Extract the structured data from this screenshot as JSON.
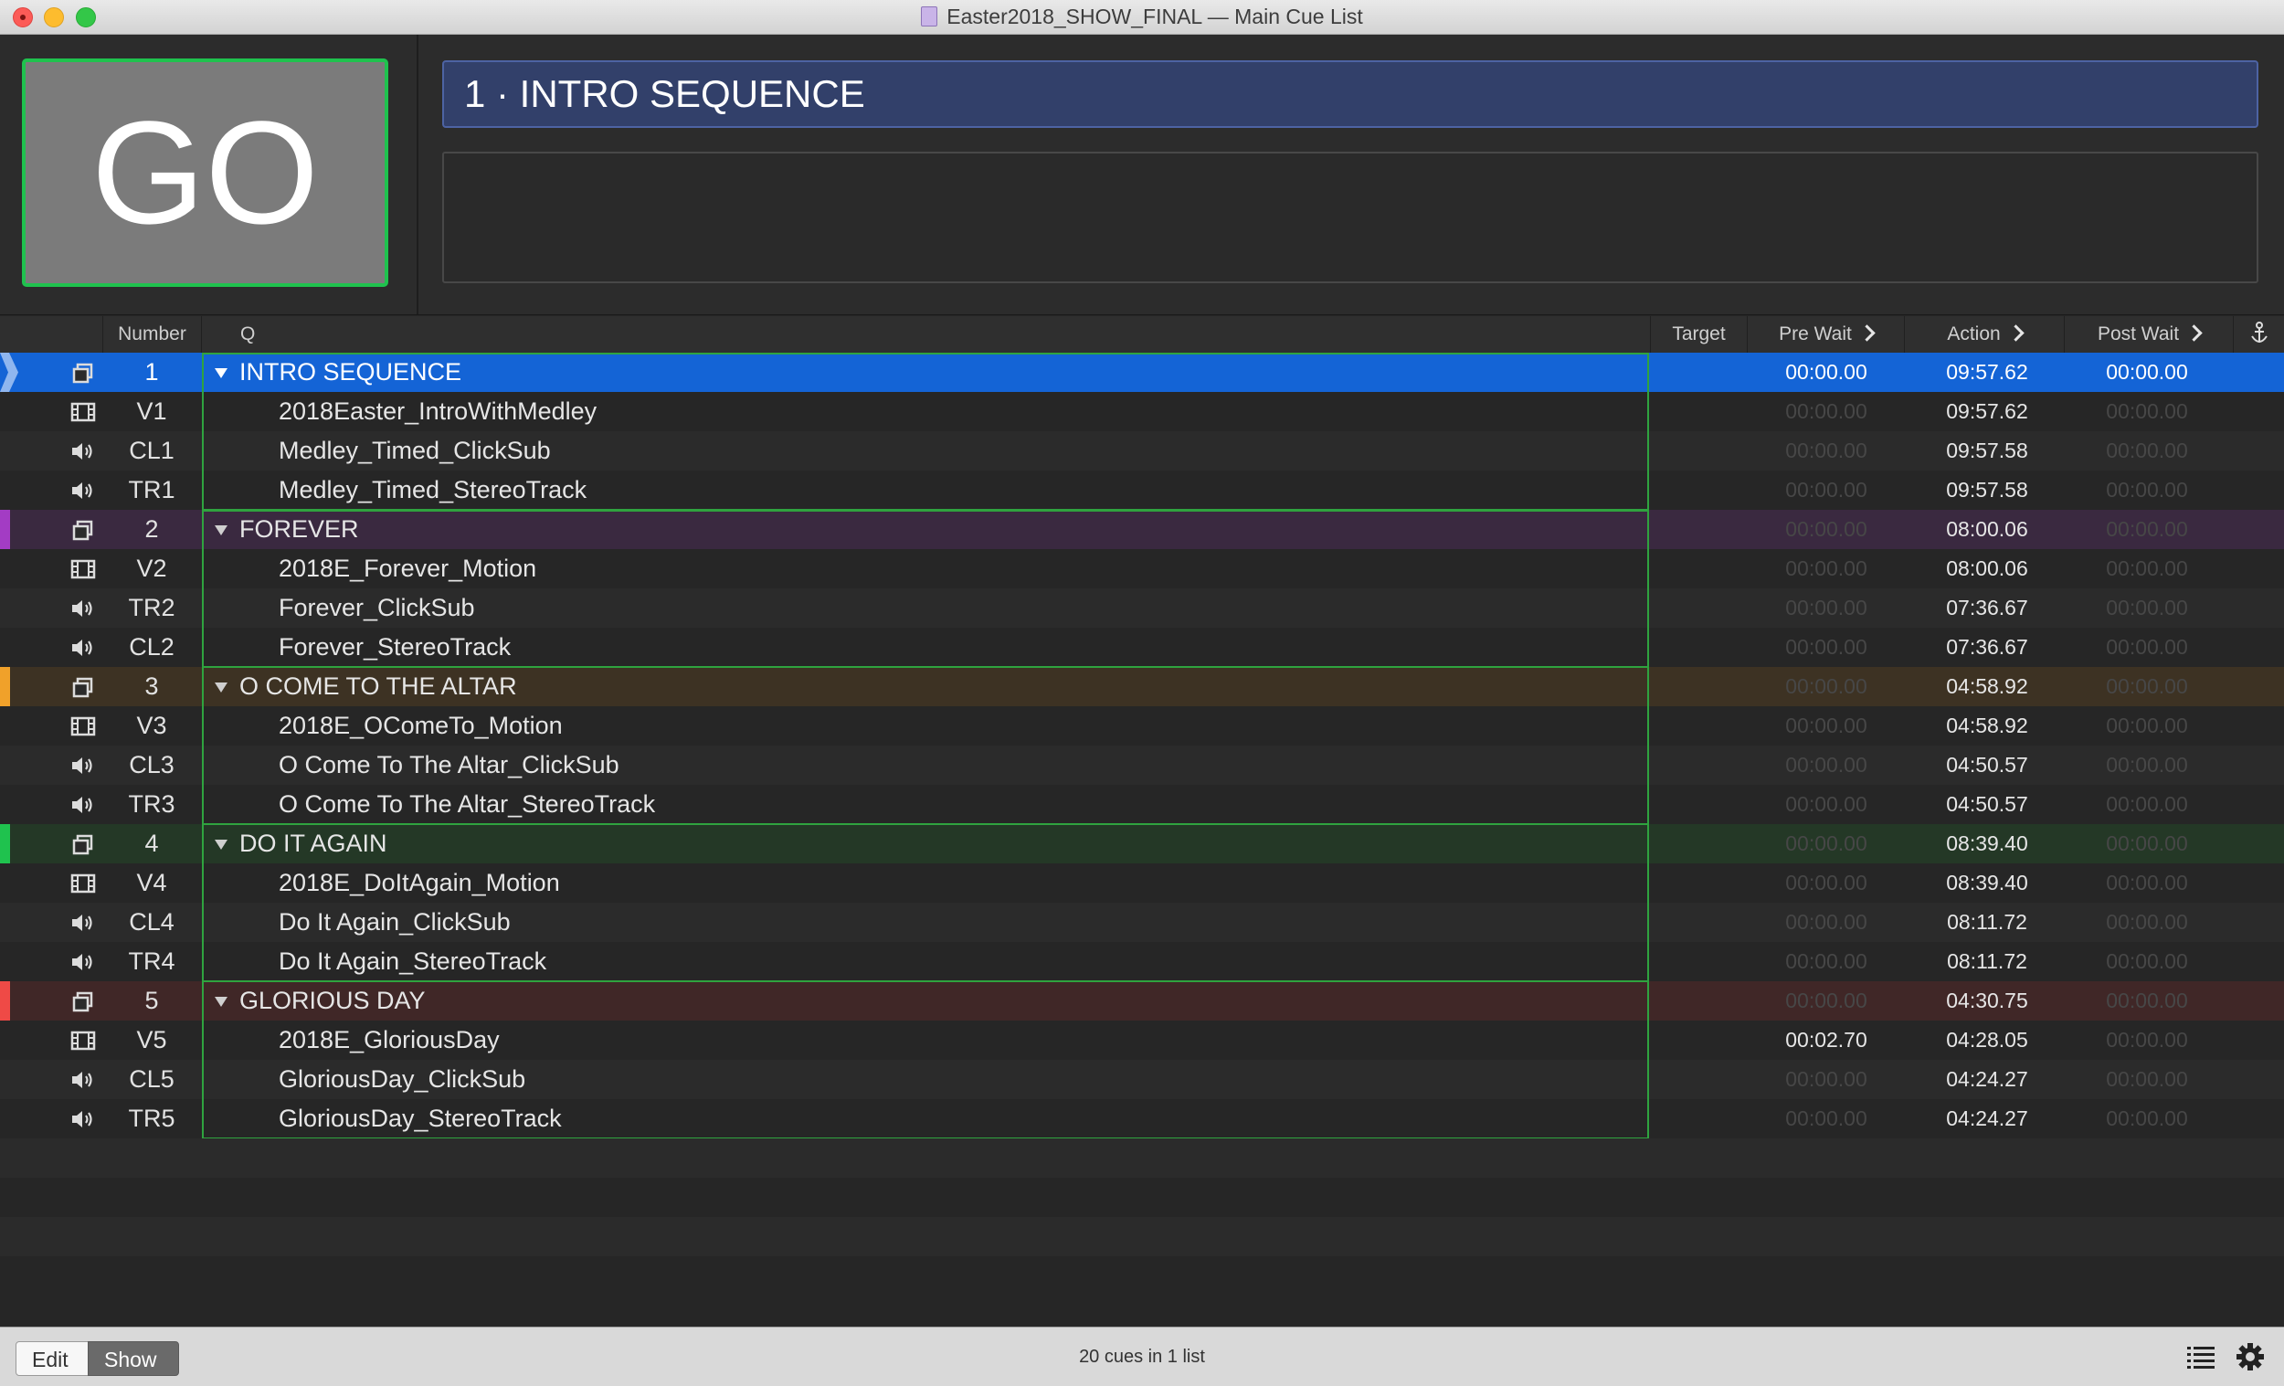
{
  "window": {
    "title": "Easter2018_SHOW_FINAL — Main Cue List"
  },
  "go_button": {
    "label": "GO"
  },
  "current_cue": {
    "display": "1 · INTRO SEQUENCE"
  },
  "columns": {
    "number": "Number",
    "q": "Q",
    "target": "Target",
    "pre_wait": "Pre Wait",
    "action": "Action",
    "post_wait": "Post Wait"
  },
  "colors": {
    "accent_selection": "#1464d6",
    "go_border": "#1fc24e",
    "group_border": "#2fa33f"
  },
  "cues": [
    {
      "num": "1",
      "name": "INTRO SEQUENCE",
      "type": "group",
      "icon": "group-icon",
      "pre": "00:00.00",
      "action": "09:57.62",
      "post": "00:00.00",
      "pre_dim": false,
      "post_dim": false,
      "selected": true,
      "color": "#1464d6"
    },
    {
      "num": "V1",
      "name": "2018Easter_IntroWithMedley",
      "type": "video",
      "icon": "film-icon",
      "pre": "00:00.00",
      "action": "09:57.62",
      "post": "00:00.00",
      "pre_dim": true,
      "post_dim": true
    },
    {
      "num": "CL1",
      "name": "Medley_Timed_ClickSub",
      "type": "audio",
      "icon": "speaker-icon",
      "pre": "00:00.00",
      "action": "09:57.58",
      "post": "00:00.00",
      "pre_dim": true,
      "post_dim": true
    },
    {
      "num": "TR1",
      "name": "Medley_Timed_StereoTrack",
      "type": "audio",
      "icon": "speaker-icon",
      "pre": "00:00.00",
      "action": "09:57.58",
      "post": "00:00.00",
      "pre_dim": true,
      "post_dim": true
    },
    {
      "num": "2",
      "name": "FOREVER",
      "type": "group",
      "icon": "group-icon",
      "pre": "00:00.00",
      "action": "08:00.06",
      "post": "00:00.00",
      "pre_dim": true,
      "post_dim": true,
      "color": "#a33cc4",
      "tint": "#3a2940"
    },
    {
      "num": "V2",
      "name": "2018E_Forever_Motion",
      "type": "video",
      "icon": "film-icon",
      "pre": "00:00.00",
      "action": "08:00.06",
      "post": "00:00.00",
      "pre_dim": true,
      "post_dim": true
    },
    {
      "num": "TR2",
      "name": "Forever_ClickSub",
      "type": "audio",
      "icon": "speaker-icon",
      "pre": "00:00.00",
      "action": "07:36.67",
      "post": "00:00.00",
      "pre_dim": true,
      "post_dim": true
    },
    {
      "num": "CL2",
      "name": "Forever_StereoTrack",
      "type": "audio",
      "icon": "speaker-icon",
      "pre": "00:00.00",
      "action": "07:36.67",
      "post": "00:00.00",
      "pre_dim": true,
      "post_dim": true
    },
    {
      "num": "3",
      "name": "O COME TO THE ALTAR",
      "type": "group",
      "icon": "group-icon",
      "pre": "00:00.00",
      "action": "04:58.92",
      "post": "00:00.00",
      "pre_dim": true,
      "post_dim": true,
      "color": "#f0a12a",
      "tint": "#3d3223"
    },
    {
      "num": "V3",
      "name": "2018E_OComeTo_Motion",
      "type": "video",
      "icon": "film-icon",
      "pre": "00:00.00",
      "action": "04:58.92",
      "post": "00:00.00",
      "pre_dim": true,
      "post_dim": true
    },
    {
      "num": "CL3",
      "name": "O Come To The Altar_ClickSub",
      "type": "audio",
      "icon": "speaker-icon",
      "pre": "00:00.00",
      "action": "04:50.57",
      "post": "00:00.00",
      "pre_dim": true,
      "post_dim": true
    },
    {
      "num": "TR3",
      "name": "O Come To The Altar_StereoTrack",
      "type": "audio",
      "icon": "speaker-icon",
      "pre": "00:00.00",
      "action": "04:50.57",
      "post": "00:00.00",
      "pre_dim": true,
      "post_dim": true
    },
    {
      "num": "4",
      "name": "DO IT AGAIN",
      "type": "group",
      "icon": "group-icon",
      "pre": "00:00.00",
      "action": "08:39.40",
      "post": "00:00.00",
      "pre_dim": true,
      "post_dim": true,
      "color": "#1fc24e",
      "tint": "#243826"
    },
    {
      "num": "V4",
      "name": "2018E_DoItAgain_Motion",
      "type": "video",
      "icon": "film-icon",
      "pre": "00:00.00",
      "action": "08:39.40",
      "post": "00:00.00",
      "pre_dim": true,
      "post_dim": true
    },
    {
      "num": "CL4",
      "name": "Do It Again_ClickSub",
      "type": "audio",
      "icon": "speaker-icon",
      "pre": "00:00.00",
      "action": "08:11.72",
      "post": "00:00.00",
      "pre_dim": true,
      "post_dim": true
    },
    {
      "num": "TR4",
      "name": "Do It Again_StereoTrack",
      "type": "audio",
      "icon": "speaker-icon",
      "pre": "00:00.00",
      "action": "08:11.72",
      "post": "00:00.00",
      "pre_dim": true,
      "post_dim": true
    },
    {
      "num": "5",
      "name": "GLORIOUS DAY",
      "type": "group",
      "icon": "group-icon",
      "pre": "00:00.00",
      "action": "04:30.75",
      "post": "00:00.00",
      "pre_dim": true,
      "post_dim": true,
      "color": "#ef4a46",
      "tint": "#402727"
    },
    {
      "num": "V5",
      "name": "2018E_GloriousDay",
      "type": "video",
      "icon": "film-icon",
      "pre": "00:02.70",
      "action": "04:28.05",
      "post": "00:00.00",
      "pre_dim": false,
      "post_dim": true
    },
    {
      "num": "CL5",
      "name": "GloriousDay_ClickSub",
      "type": "audio",
      "icon": "speaker-icon",
      "pre": "00:00.00",
      "action": "04:24.27",
      "post": "00:00.00",
      "pre_dim": true,
      "post_dim": true
    },
    {
      "num": "TR5",
      "name": "GloriousDay_StereoTrack",
      "type": "audio",
      "icon": "speaker-icon",
      "pre": "00:00.00",
      "action": "04:24.27",
      "post": "00:00.00",
      "pre_dim": true,
      "post_dim": true
    }
  ],
  "footer": {
    "edit_label": "Edit",
    "show_label": "Show",
    "status": "20 cues in 1 list",
    "list_icon": "list-icon",
    "settings_icon": "gear-icon"
  }
}
